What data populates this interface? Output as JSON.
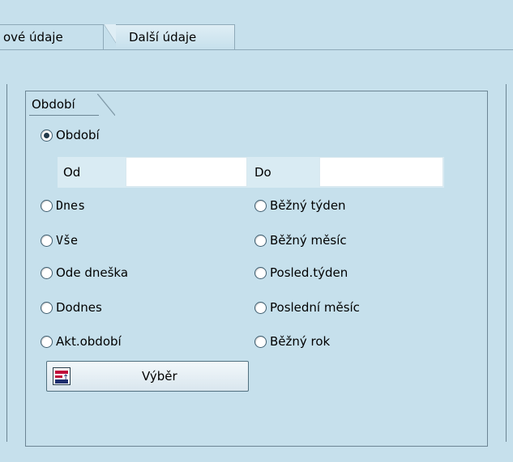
{
  "tabs": {
    "active_label": "ové údaje",
    "second_label": "Další údaje"
  },
  "group": {
    "title": "Období"
  },
  "radios": {
    "period": "Období",
    "today": "Dnes",
    "all": "Vše",
    "from_today": "Ode dneška",
    "until_today": "Dodnes",
    "current_period": "Akt.období",
    "current_week": "Běžný týden",
    "current_month": "Běžný měsíc",
    "last_week": "Posled.týden",
    "last_month": "Poslední měsíc",
    "current_year": "Běžný rok",
    "selected": "period"
  },
  "fields": {
    "from_label": "Od",
    "to_label": "Do",
    "from_value": "",
    "to_value": ""
  },
  "button": {
    "label": "Výběr",
    "icon": "selection-icon"
  },
  "colors": {
    "background": "#c6e0ec",
    "frame": "#6c8594",
    "icon_red": "#c00d3b",
    "icon_navy": "#1f2e6f"
  }
}
